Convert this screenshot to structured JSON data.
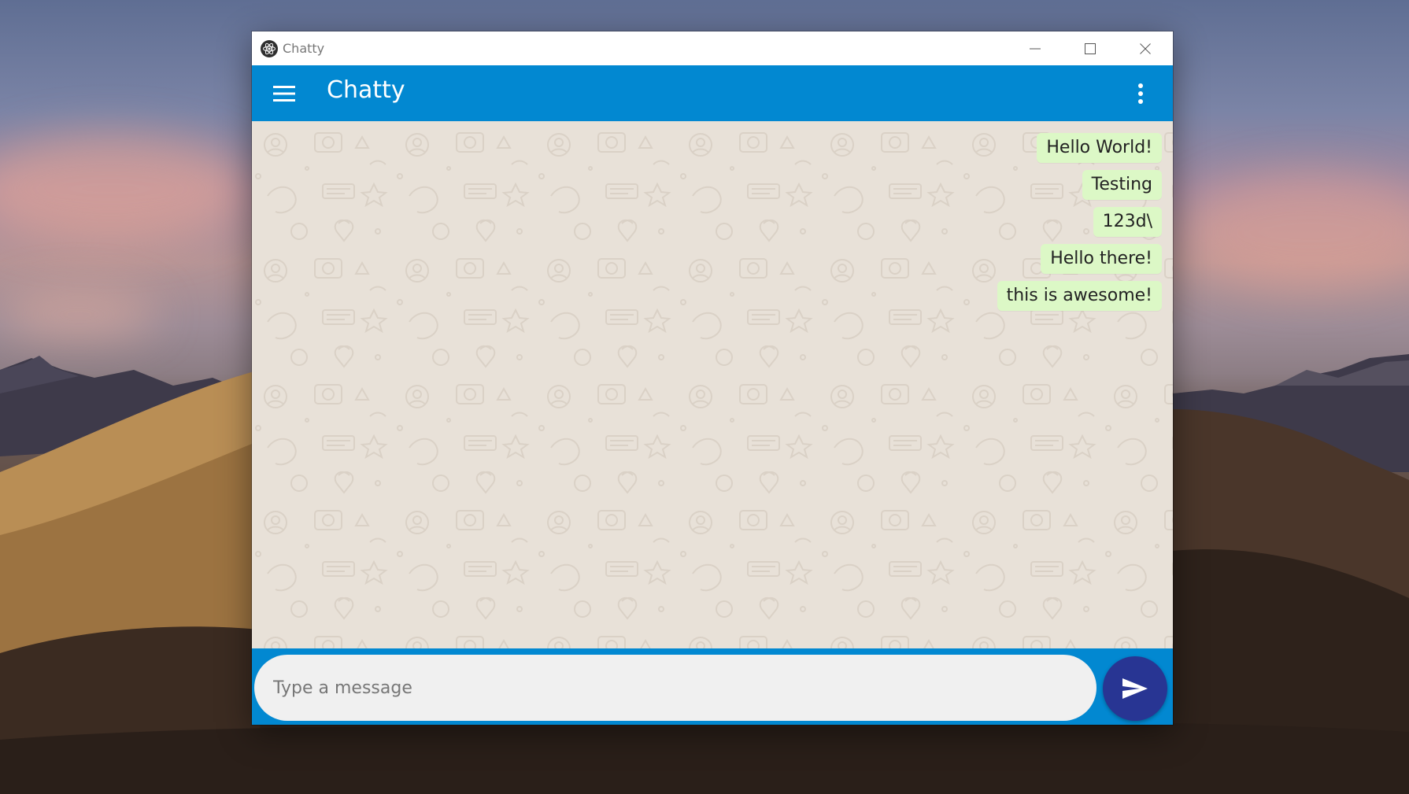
{
  "window": {
    "title": "Chatty"
  },
  "appbar": {
    "title": "Chatty"
  },
  "messages": [
    {
      "text": "Hello World!"
    },
    {
      "text": "Testing"
    },
    {
      "text": "123d\\"
    },
    {
      "text": "Hello there!"
    },
    {
      "text": "this is awesome!"
    }
  ],
  "composer": {
    "placeholder": "Type a message",
    "value": ""
  },
  "colors": {
    "primary": "#0288d1",
    "send_button": "#283593",
    "bubble": "#dcf8c6",
    "chat_background": "#e8e1d8"
  },
  "icons": {
    "app": "electron-icon",
    "menu": "hamburger-menu-icon",
    "more": "more-vertical-icon",
    "send": "send-icon",
    "minimize": "minimize-icon",
    "maximize": "maximize-icon",
    "close": "close-icon"
  }
}
